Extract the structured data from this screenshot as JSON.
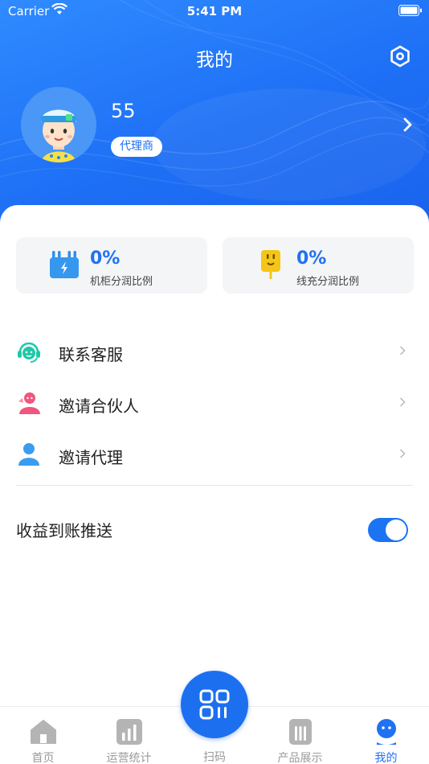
{
  "status_bar": {
    "carrier": "Carrier",
    "time": "5:41 PM"
  },
  "header": {
    "title": "我的"
  },
  "profile": {
    "name": "55",
    "role": "代理商"
  },
  "stats": [
    {
      "value": "0%",
      "label": "机柜分润比例",
      "icon": "cabinet-battery-icon"
    },
    {
      "value": "0%",
      "label": "线充分润比例",
      "icon": "charging-plug-icon"
    }
  ],
  "menu": [
    {
      "label": "联系客服",
      "icon": "customer-service-icon"
    },
    {
      "label": "邀请合伙人",
      "icon": "partner-icon"
    },
    {
      "label": "邀请代理",
      "icon": "agent-icon"
    }
  ],
  "push_setting": {
    "label": "收益到账推送",
    "enabled": true
  },
  "tabbar": {
    "home": "首页",
    "stats": "运营统计",
    "scan": "扫码",
    "products": "产品展示",
    "mine": "我的"
  },
  "colors": {
    "primary": "#1f72f2",
    "header": "#1e6ff5",
    "stat_bg": "#f4f5f7"
  }
}
